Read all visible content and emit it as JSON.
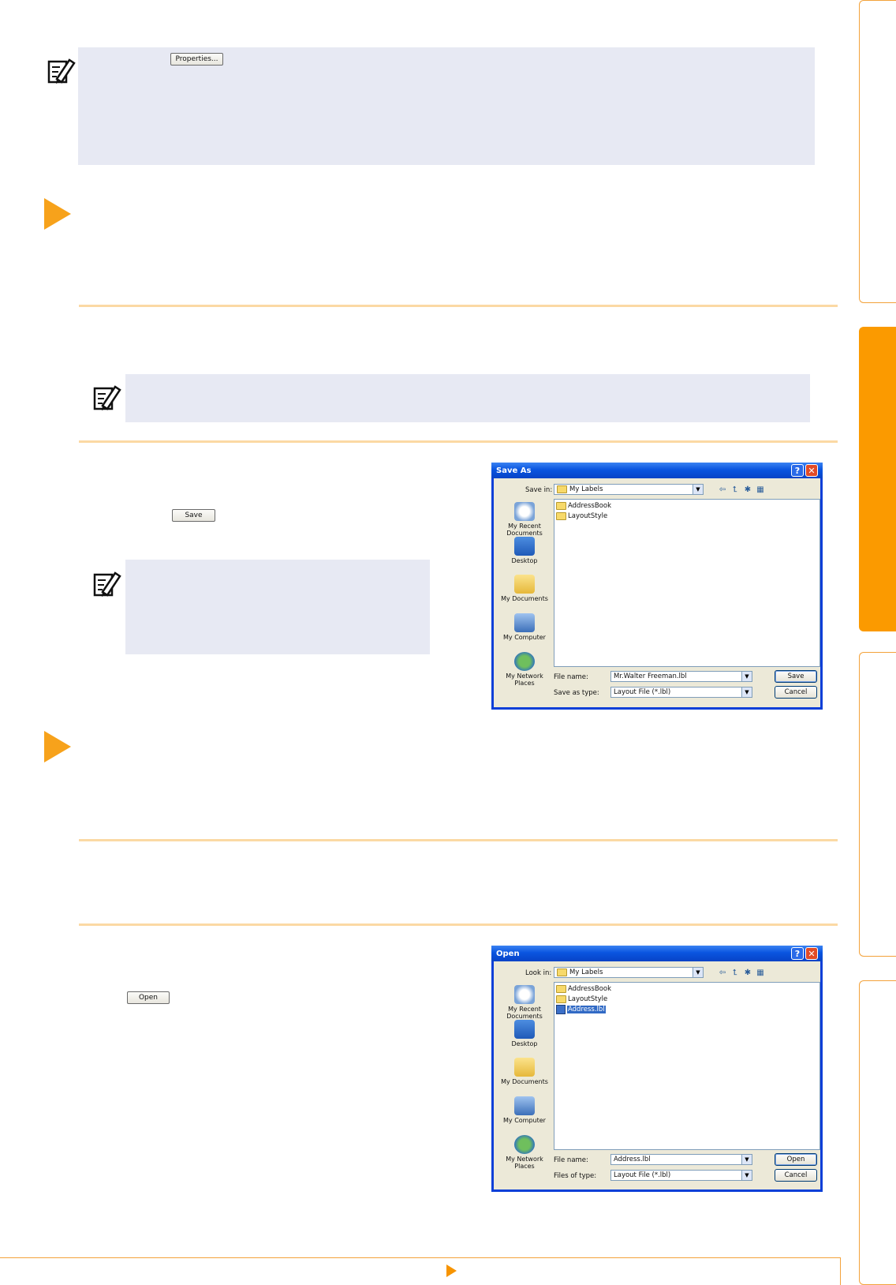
{
  "note_top": {
    "button_label": "Properties..."
  },
  "step1": {
    "save_button_label": "Save"
  },
  "step2": {
    "open_button_label": "Open"
  },
  "save_dialog": {
    "title": "Save As",
    "location_label": "Save in:",
    "location_value": "My Labels",
    "places": [
      "My Recent Documents",
      "Desktop",
      "My Documents",
      "My Computer",
      "My Network Places"
    ],
    "files": [
      {
        "name": "AddressBook",
        "type": "folder",
        "selected": false
      },
      {
        "name": "LayoutStyle",
        "type": "folder",
        "selected": false
      }
    ],
    "filename_label": "File name:",
    "filename_value": "Mr.Walter Freeman.lbl",
    "filetype_label": "Save as type:",
    "filetype_value": "Layout File (*.lbl)",
    "primary_button": "Save",
    "cancel_button": "Cancel"
  },
  "open_dialog": {
    "title": "Open",
    "location_label": "Look in:",
    "location_value": "My Labels",
    "places": [
      "My Recent Documents",
      "Desktop",
      "My Documents",
      "My Computer",
      "My Network Places"
    ],
    "files": [
      {
        "name": "AddressBook",
        "type": "folder",
        "selected": false
      },
      {
        "name": "LayoutStyle",
        "type": "folder",
        "selected": false
      },
      {
        "name": "Address.lbl",
        "type": "label",
        "selected": true
      }
    ],
    "filename_label": "File name:",
    "filename_value": "Address.lbl",
    "filetype_label": "Files of type:",
    "filetype_value": "Layout File (*.lbl)",
    "primary_button": "Open",
    "cancel_button": "Cancel"
  },
  "colors": {
    "accent": "#fb9a00",
    "note_bg": "#e7e9f3",
    "rule": "#fbd9a4"
  },
  "icons": [
    "memo-pencil-icon",
    "next-page-arrow-icon"
  ]
}
